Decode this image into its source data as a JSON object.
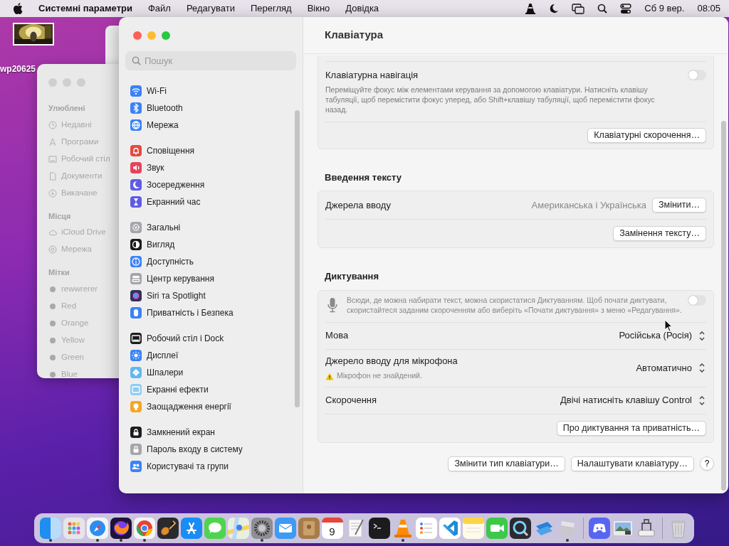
{
  "menu_bar": {
    "app_name": "Системні параметри",
    "menus": [
      "Файл",
      "Редагувати",
      "Перегляд",
      "Вікно",
      "Довідка"
    ],
    "date": "Сб 9 вер.",
    "time": "08:05"
  },
  "desktop_icon": {
    "label": "wp20625"
  },
  "finder_sidebar": {
    "sections": [
      {
        "title": "Улюблені",
        "items": [
          {
            "label": "Недавні",
            "kind": "clock"
          },
          {
            "label": "Програми",
            "kind": "apps"
          },
          {
            "label": "Робочий стіл",
            "kind": "desktop"
          },
          {
            "label": "Документи",
            "kind": "document"
          },
          {
            "label": "Викачане",
            "kind": "download"
          }
        ]
      },
      {
        "title": "Місця",
        "items": [
          {
            "label": "iCloud Drive",
            "kind": "cloud"
          },
          {
            "label": "Мережа",
            "kind": "network"
          }
        ]
      },
      {
        "title": "Мітки",
        "items": [
          {
            "label": "rewwrerer",
            "kind": "tag"
          },
          {
            "label": "Red",
            "kind": "tag"
          },
          {
            "label": "Orange",
            "kind": "tag"
          },
          {
            "label": "Yellow",
            "kind": "tag"
          },
          {
            "label": "Green",
            "kind": "tag"
          },
          {
            "label": "Blue",
            "kind": "tag"
          }
        ]
      }
    ]
  },
  "settings": {
    "search": {
      "placeholder": "Пошук"
    },
    "sidebar_groups": [
      [
        {
          "label": "Wi-Fi",
          "color": "#3a82f7"
        },
        {
          "label": "Bluetooth",
          "color": "#3a82f7"
        },
        {
          "label": "Мережа",
          "color": "#3a82f7"
        }
      ],
      [
        {
          "label": "Сповіщення",
          "color": "#e5493f"
        },
        {
          "label": "Звук",
          "color": "#e8415a"
        },
        {
          "label": "Зосередження",
          "color": "#5e5ce6"
        },
        {
          "label": "Екранний час",
          "color": "#5e5ce6"
        }
      ],
      [
        {
          "label": "Загальні",
          "color": "#a5a5aa"
        },
        {
          "label": "Вигляд",
          "color": "#1c1c1e"
        },
        {
          "label": "Доступність",
          "color": "#3a82f7"
        },
        {
          "label": "Центр керування",
          "color": "#a5a5aa"
        },
        {
          "label": "Siri та Spotlight",
          "color": "#35305a"
        },
        {
          "label": "Приватність і Безпека",
          "color": "#3a82f7"
        }
      ],
      [
        {
          "label": "Робочий стіл і Dock",
          "color": "#1c1c1e"
        },
        {
          "label": "Дисплеї",
          "color": "#3a82f7"
        },
        {
          "label": "Шпалери",
          "color": "#62b8ee"
        },
        {
          "label": "Екранні ефекти",
          "color": "#8fcdf0"
        },
        {
          "label": "Заощадження енергії",
          "color": "#f4a623"
        }
      ],
      [
        {
          "label": "Замкнений екран",
          "color": "#1c1c1e"
        },
        {
          "label": "Пароль входу в систему",
          "color": "#a5a5aa"
        },
        {
          "label": "Користувачі та групи",
          "color": "#3a82f7"
        }
      ]
    ],
    "title": "Клавіатура",
    "keyboard_navigation": {
      "title": "Клавіатурна навігація",
      "description": "Переміщуйте фокус між елементами керування за допомогою клавіатури. Натисніть клавішу табуляції, щоб перемістити фокус уперед, або Shift+клавішу табуляції, щоб перемістити фокус назад.",
      "on": false,
      "button": "Клавіатурні скорочення…"
    },
    "text_input": {
      "title": "Введення тексту",
      "input_sources": {
        "label": "Джерела вводу",
        "value": "Американська і Українська",
        "button": "Змінити…"
      },
      "button": "Замінення тексту…"
    },
    "dictation": {
      "title": "Диктування",
      "description": "Всюди, де можна набирати текст, можна скористатися Диктуванням. Щоб почати диктувати, скористайтеся заданим скороченням або виберіть «Почати диктування» з меню «Редагування».",
      "on": false,
      "rows": [
        {
          "label": "Мова",
          "value": "Російська (Росія)"
        },
        {
          "label": "Джерело вводу для мікрофона",
          "value": "Автоматично",
          "warning": "Мікрофон не знайдений."
        },
        {
          "label": "Скорочення",
          "value": "Двічі натисніть клавішу Control"
        }
      ],
      "button": "Про диктування та приватність…"
    },
    "footer_buttons": [
      "Змінити тип клавіатури…",
      "Налаштувати клавіатуру…"
    ],
    "help": "?"
  },
  "dock": {
    "groups": [
      [
        {
          "running": true
        },
        {
          "running": false
        },
        {
          "running": true
        },
        {
          "running": true
        },
        {
          "running": true
        },
        {
          "running": false
        },
        {
          "running": false
        },
        {
          "running": false
        },
        {
          "running": false
        },
        {
          "running": true
        },
        {
          "running": false
        },
        {
          "running": false
        },
        {
          "running": false,
          "label": "9"
        },
        {
          "running": false
        },
        {
          "running": false
        },
        {
          "running": true
        },
        {
          "running": false
        },
        {
          "running": false
        },
        {
          "running": false
        },
        {
          "running": false
        },
        {
          "running": false
        },
        {
          "running": false
        },
        {
          "running": true
        }
      ],
      [
        {
          "running": false
        },
        {
          "running": false
        },
        {
          "running": false
        }
      ],
      [
        {
          "running": false
        }
      ]
    ]
  }
}
